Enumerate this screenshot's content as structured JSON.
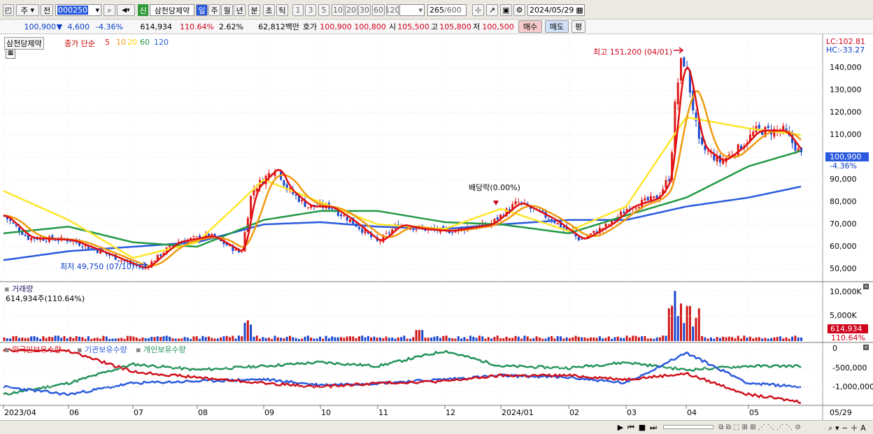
{
  "toolbar": {
    "market": "주",
    "period_mode": "전",
    "code": "000250",
    "badge": "신",
    "stock_name": "삼천당제약",
    "intervals": [
      "일",
      "주",
      "월",
      "년",
      "분",
      "초",
      "틱"
    ],
    "numbers": [
      "1",
      "3",
      "5",
      "10",
      "20",
      "30",
      "60",
      "120"
    ],
    "count": "265",
    "count_total": "/600",
    "date": "2024/05/29"
  },
  "quote": {
    "price": "100,900",
    "arrow": "▼",
    "change": "4,600",
    "change_pct": "-4.36%",
    "volume": "614,934",
    "vol_ratio": "110.64%",
    "turnover": "2.62%",
    "amount": "62,812백만",
    "bid_label": "호가",
    "ask": "100,900",
    "bid": "100,800",
    "open_label": "시",
    "open": "105,500",
    "high_label": "고",
    "high": "105,800",
    "low_label": "저",
    "low": "100,500",
    "buy_label": "매수",
    "sell_label": "매도",
    "eval_label": "평"
  },
  "price_panel": {
    "title": "삼천당제약",
    "ma_label": "종가 단순",
    "ma_periods": [
      "5",
      "10",
      "20",
      "60",
      "120"
    ],
    "ma_colors": [
      "#e01010",
      "#f09a10",
      "#ffd400",
      "#229944",
      "#2a5ade"
    ],
    "lc": "LC:102.81",
    "hc": "HC:-33.27",
    "y_ticks": [
      "140,000",
      "130,000",
      "120,000",
      "110,000",
      "100,000",
      "90,000",
      "80,000",
      "70,000",
      "60,000",
      "50,000"
    ],
    "current_price": "100,900",
    "current_pct": "-4.36%",
    "high_note": "최고 151,200 (04/01)",
    "low_note": "최저 49,750 (07/10)",
    "dividend_note": "배당락(0.00%)"
  },
  "volume_panel": {
    "title": "거래량",
    "value": "614,934주(110.64%)",
    "y_ticks": [
      "10,000K",
      "5,000K"
    ],
    "current": "614,934",
    "current_pct": "110.64%"
  },
  "holding_panel": {
    "series": [
      "외국인보유수량",
      "기관보유수량",
      "개인보유수량"
    ],
    "colors": [
      "#d0101a",
      "#2a5ade",
      "#22925a"
    ],
    "y_ticks": [
      "0",
      "-500,000",
      "-1,000,000"
    ]
  },
  "x_axis": [
    "2023/04",
    "06",
    "07",
    "08",
    "09",
    "10",
    "11",
    "12",
    "2024/01",
    "02",
    "03",
    "04",
    "05"
  ],
  "x_end": "05/29",
  "chart_data": {
    "type": "line",
    "price_panel": {
      "x": [
        "2023/04",
        "06",
        "07",
        "08",
        "09",
        "10",
        "11",
        "12",
        "2024/01",
        "02",
        "03",
        "04",
        "05",
        "05/29"
      ],
      "close": [
        74000,
        63000,
        52000,
        63000,
        96000,
        80000,
        68000,
        66000,
        78000,
        66000,
        82000,
        140000,
        112000,
        100900
      ],
      "ma20": [
        85000,
        72000,
        55000,
        62000,
        90000,
        80000,
        70000,
        68000,
        77000,
        67000,
        78000,
        118000,
        113000,
        110000
      ],
      "ma60": [
        66000,
        69000,
        62000,
        60000,
        72000,
        76000,
        76000,
        71000,
        70000,
        66000,
        74000,
        82000,
        96000,
        103000
      ],
      "ma120": [
        54000,
        58000,
        60000,
        62000,
        70000,
        71000,
        69000,
        68000,
        70000,
        72000,
        72000,
        78000,
        82000,
        87000
      ],
      "ylim": [
        45000,
        150000
      ]
    },
    "volume_panel": {
      "ylim": [
        0,
        11000
      ]
    },
    "holding_panel": {
      "x": [
        "2023/04",
        "06",
        "07",
        "08",
        "09",
        "10",
        "11",
        "12",
        "2024/01",
        "02",
        "03",
        "04",
        "05",
        "05/29"
      ],
      "foreign": [
        -30000,
        -50000,
        -600000,
        -750000,
        -900000,
        -1000000,
        -900000,
        -850000,
        -700000,
        -700000,
        -800000,
        -650000,
        -1200000,
        -1400000
      ],
      "institution": [
        -1000000,
        -1200000,
        -900000,
        -850000,
        -800000,
        -950000,
        -900000,
        -800000,
        -700000,
        -750000,
        -900000,
        -100000,
        -900000,
        -1000000
      ],
      "individual": [
        -1200000,
        -900000,
        -400000,
        -550000,
        -450000,
        -350000,
        -450000,
        -50000,
        -450000,
        -500000,
        -350000,
        -550000,
        -450000,
        -450000
      ],
      "ylim": [
        -1450000,
        100000
      ]
    }
  }
}
